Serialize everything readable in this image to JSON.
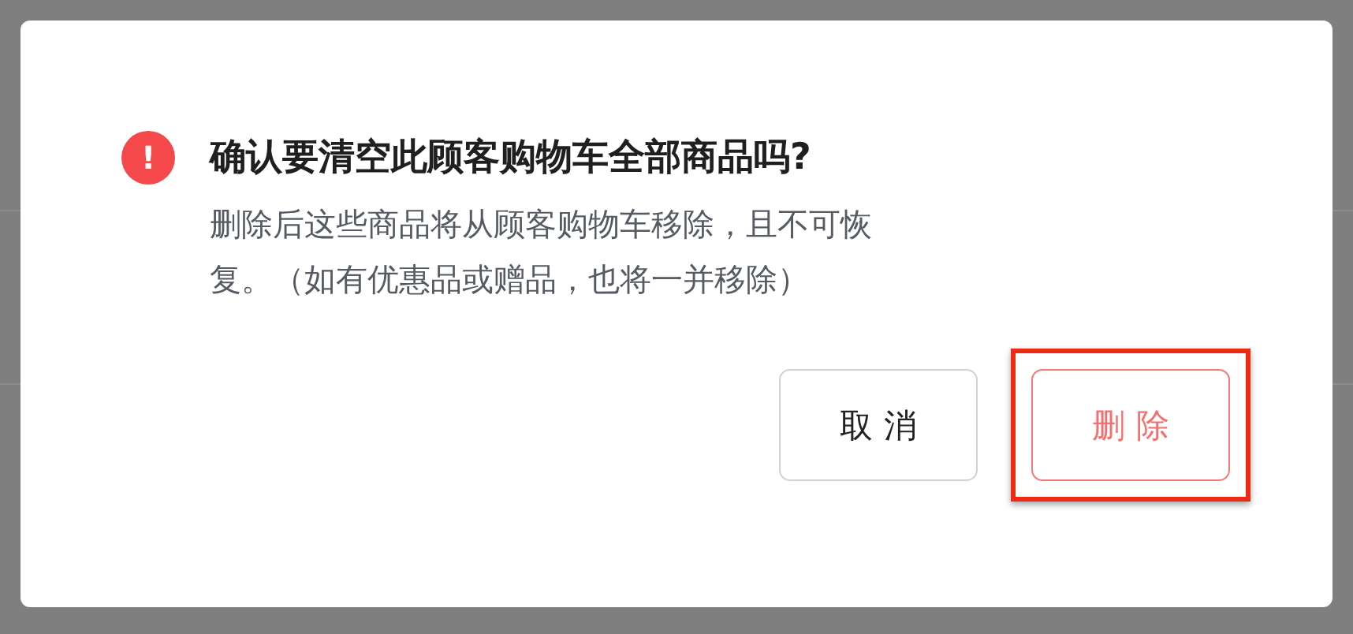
{
  "dialog": {
    "icon": "!",
    "title": "确认要清空此顾客购物车全部商品吗?",
    "message": "删除后这些商品将从顾客购物车移除，且不可恢复。（如有优惠品或赠品，也将一并移除）",
    "buttons": [
      {
        "label": "取 消",
        "kind": "default",
        "highlighted": false
      },
      {
        "label": "删 除",
        "kind": "danger",
        "highlighted": true
      }
    ]
  }
}
